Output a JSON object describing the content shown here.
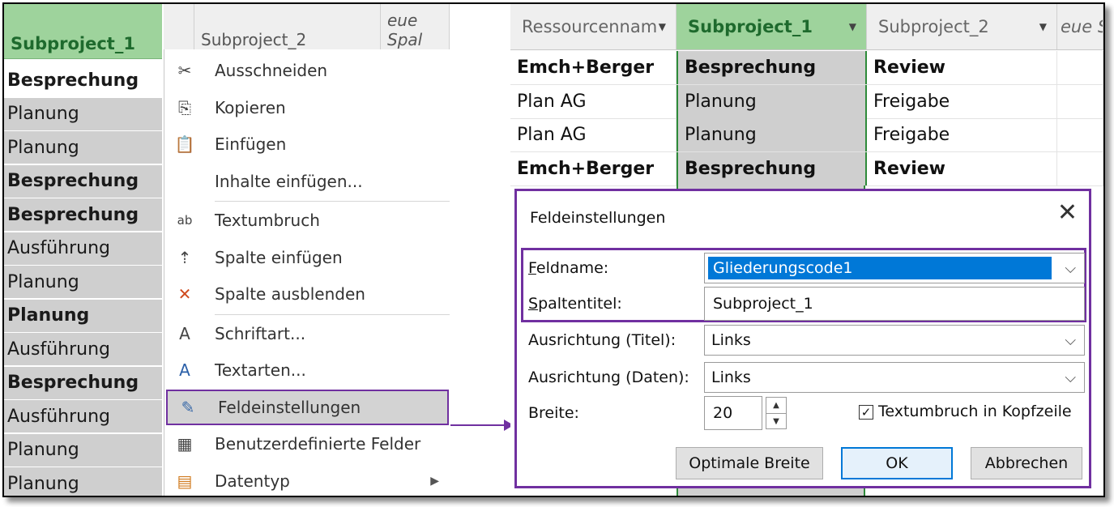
{
  "left": {
    "header_label": "Subproject_1",
    "header_strip": [
      "",
      "Subproject_2",
      "eue Spal"
    ],
    "rows": [
      {
        "text": "Besprechung",
        "bold": true
      },
      {
        "text": "Planung",
        "bold": false
      },
      {
        "text": "Planung",
        "bold": false
      },
      {
        "text": "Besprechung",
        "bold": true
      },
      {
        "text": "Besprechung",
        "bold": true
      },
      {
        "text": "Ausführung",
        "bold": false
      },
      {
        "text": "Planung",
        "bold": false
      },
      {
        "text": "Planung",
        "bold": true
      },
      {
        "text": "Ausführung",
        "bold": false
      },
      {
        "text": "Besprechung",
        "bold": true
      },
      {
        "text": "Ausführung",
        "bold": false
      },
      {
        "text": "Planung",
        "bold": false
      },
      {
        "text": "Planung",
        "bold": false
      }
    ]
  },
  "context_menu": {
    "items": [
      {
        "label": "Ausschneiden",
        "icon": "scissors-icon"
      },
      {
        "label": "Kopieren",
        "icon": "copy-icon"
      },
      {
        "label": "Einfügen",
        "icon": "paste-icon"
      },
      {
        "label": "Inhalte einfügen...",
        "icon": ""
      },
      {
        "label": "Textumbruch",
        "icon": "wrap-text-icon"
      },
      {
        "label": "Spalte einfügen",
        "icon": "insert-column-icon"
      },
      {
        "label": "Spalte ausblenden",
        "icon": "hide-column-icon"
      },
      {
        "label": "Schriftart...",
        "icon": "font-icon"
      },
      {
        "label": "Textarten...",
        "icon": "text-styles-icon"
      },
      {
        "label": "Feldeinstellungen",
        "icon": "field-settings-icon"
      },
      {
        "label": "Benutzerdefinierte Felder",
        "icon": "custom-fields-icon"
      },
      {
        "label": "Datentyp",
        "icon": "data-type-icon"
      }
    ]
  },
  "grid": {
    "headers": [
      "Ressourcennam",
      "Subproject_1",
      "Subproject_2",
      "eue Sp"
    ],
    "rows": [
      {
        "c1": "Emch+Berger",
        "c2": "Besprechung",
        "c3": "Review",
        "bold": true
      },
      {
        "c1": "Plan AG",
        "c2": "Planung",
        "c3": "Freigabe",
        "bold": false
      },
      {
        "c1": "Plan AG",
        "c2": "Planung",
        "c3": "Freigabe",
        "bold": false
      },
      {
        "c1": "Emch+Berger",
        "c2": "Besprechung",
        "c3": "Review",
        "bold": true
      }
    ]
  },
  "dialog": {
    "title": "Feldeinstellungen",
    "close": "✕",
    "field_name_label": "Feldname:",
    "field_name_value": "Gliederungscode1",
    "column_title_label": "Spaltentitel:",
    "column_title_value": "Subproject_1",
    "align_title_label": "Ausrichtung (Titel):",
    "align_title_value": "Links",
    "align_data_label": "Ausrichtung (Daten):",
    "align_data_value": "Links",
    "width_label": "Breite:",
    "width_value": "20",
    "wrap_label": "Textumbruch in Kopfzeile",
    "wrap_checked": true,
    "btn_optimal": "Optimale Breite",
    "btn_ok": "OK",
    "btn_cancel": "Abbrechen"
  },
  "colors": {
    "accent": "#7030a0",
    "header_green": "#9ed39c",
    "selection_blue": "#0078d7"
  }
}
